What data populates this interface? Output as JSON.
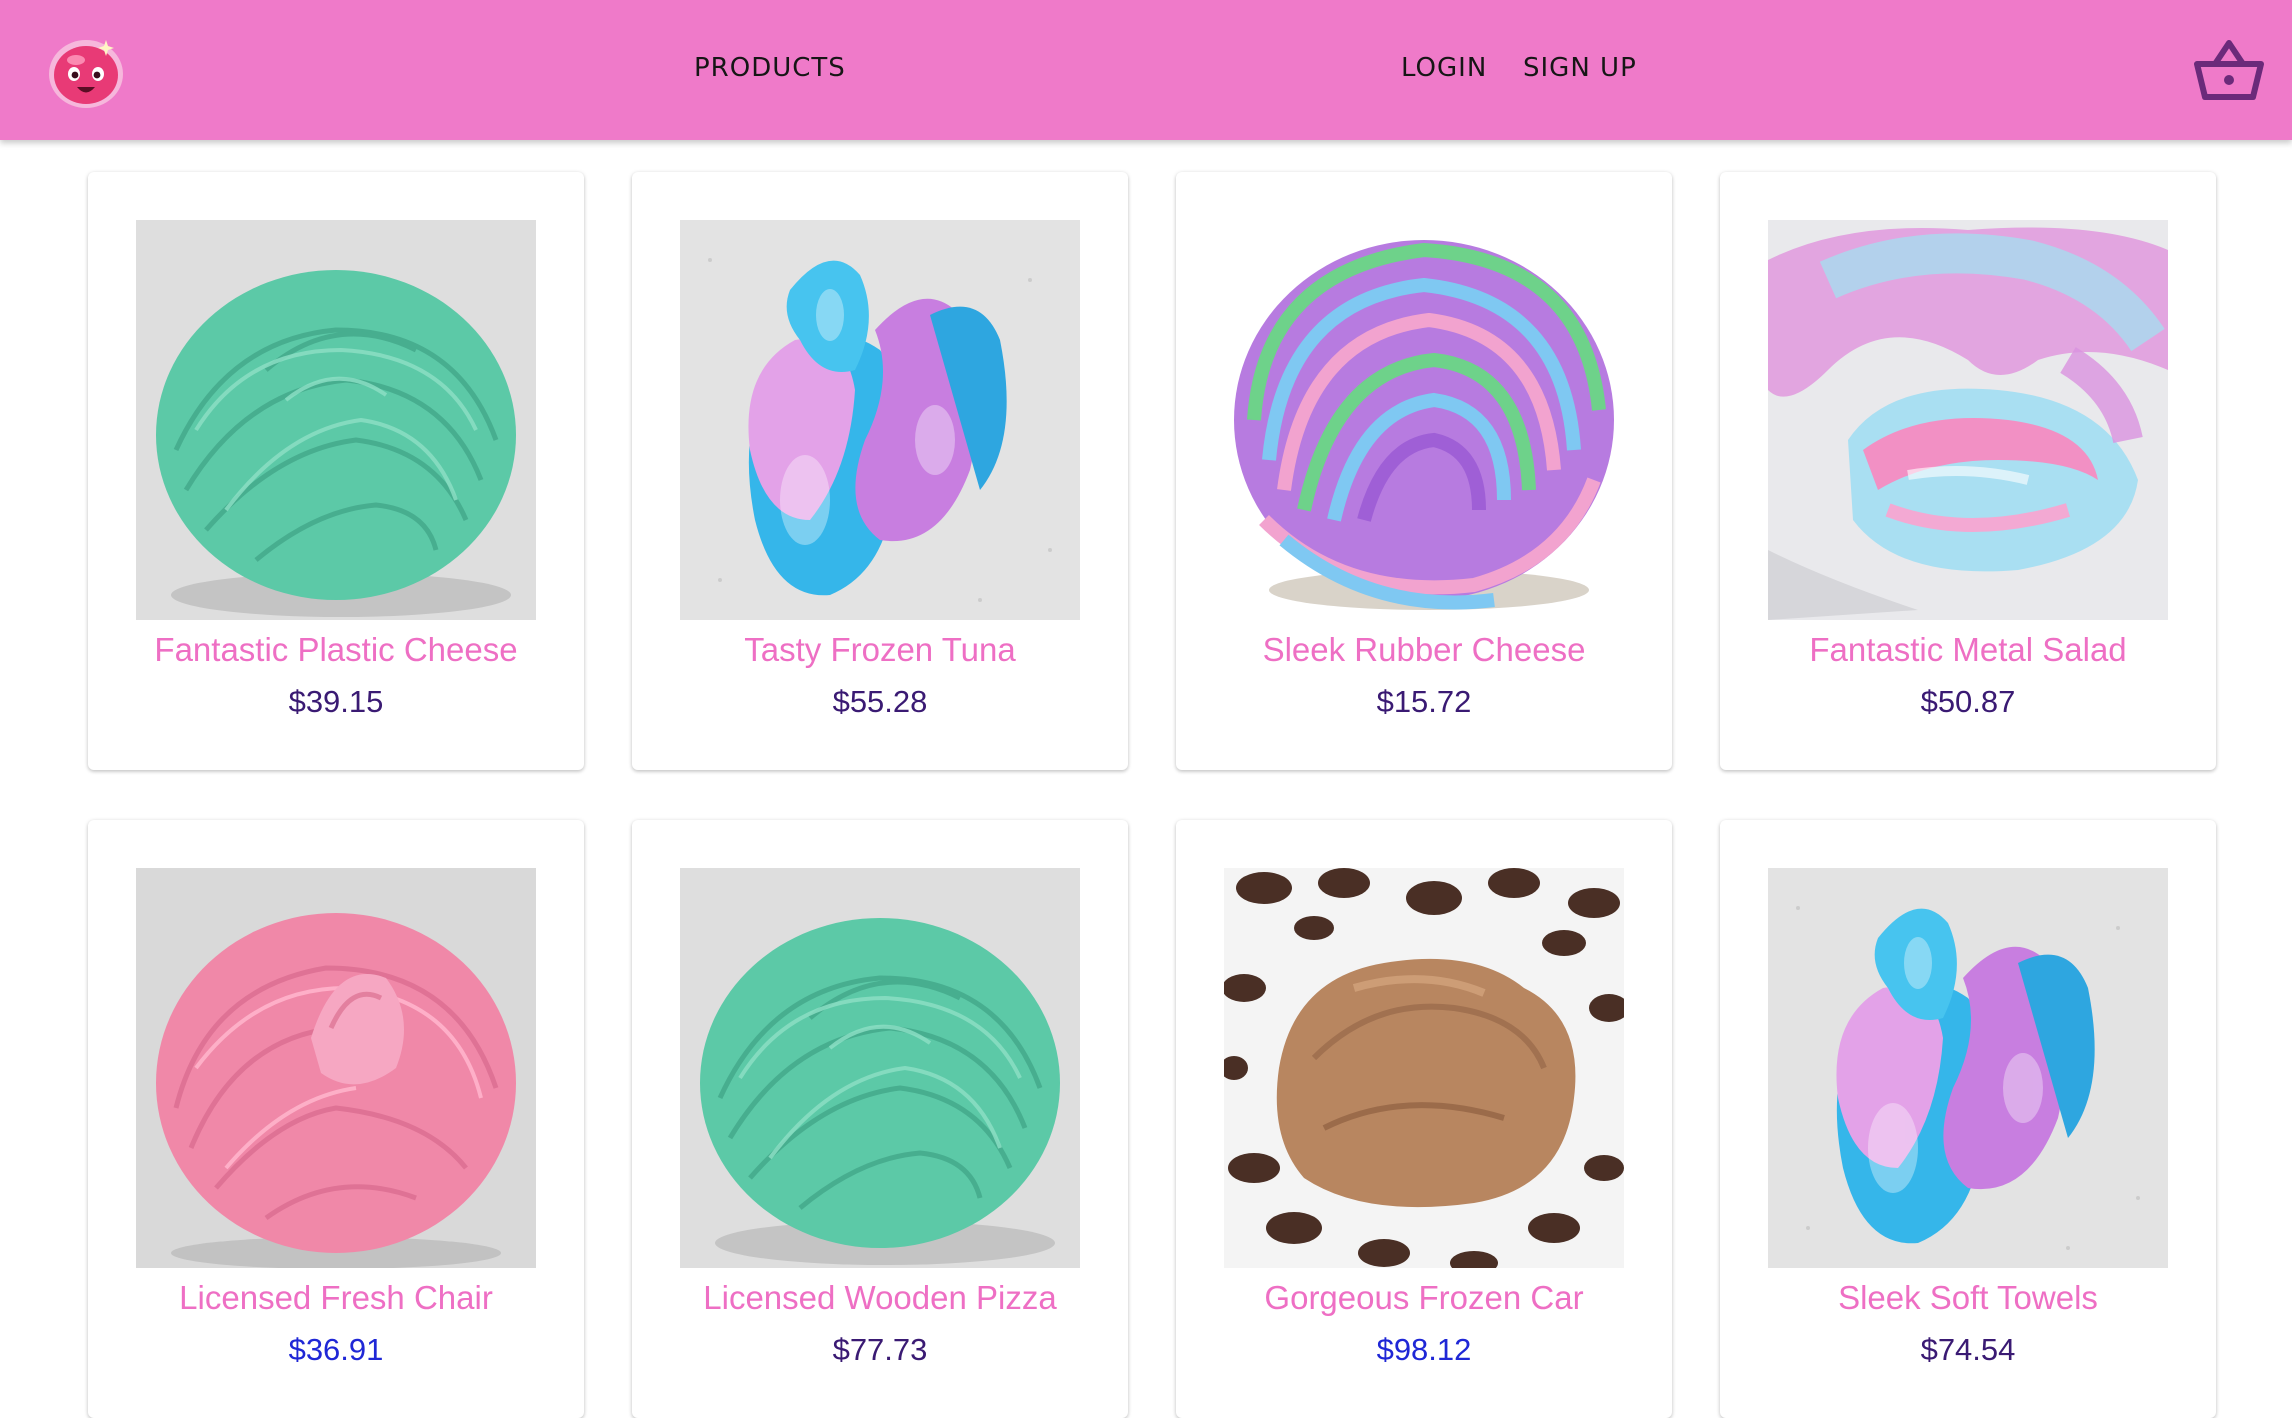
{
  "navbar": {
    "background": "#ef7ac9",
    "logo_icon": "pink-slime-mascot-icon",
    "links": [
      {
        "label": "PRODUCTS"
      },
      {
        "label": "LOGIN"
      },
      {
        "label": "SIGN UP"
      }
    ],
    "cart_icon": "shopping-basket-icon"
  },
  "products": [
    {
      "name": "Fantastic Plastic Cheese",
      "price": "$39.15",
      "image": "teal-slime-swirl"
    },
    {
      "name": "Tasty Frozen Tuna",
      "price": "$55.28",
      "image": "blue-pink-glitter-slime-twist"
    },
    {
      "name": "Sleek Rubber Cheese",
      "price": "$15.72",
      "image": "rainbow-striped-slime-swirl"
    },
    {
      "name": "Fantastic Metal Salad",
      "price": "$50.87",
      "image": "pastel-fluffy-slime-coil"
    },
    {
      "name": "Licensed Fresh Chair",
      "price": "$36.91",
      "image": "pink-slime-swirl"
    },
    {
      "name": "Licensed Wooden Pizza",
      "price": "$77.73",
      "image": "teal-slime-swirl"
    },
    {
      "name": "Gorgeous Frozen Car",
      "price": "$98.12",
      "image": "chocolate-slime-with-chips"
    },
    {
      "name": "Sleek Soft Towels",
      "price": "$74.54",
      "image": "blue-pink-glitter-slime-twist"
    }
  ],
  "colors": {
    "product_name": "#ee6fc4",
    "price": "#3a1a73",
    "price_highlight": "#1f27d6"
  }
}
